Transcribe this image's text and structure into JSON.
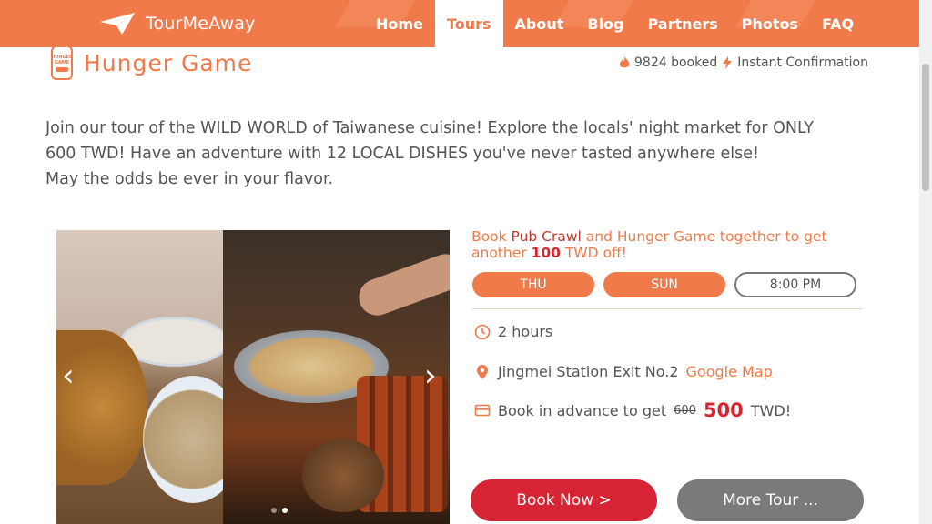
{
  "nav": {
    "brand": "TourMeAway",
    "items": [
      {
        "label": "Home",
        "active": false
      },
      {
        "label": "Tours",
        "active": true
      },
      {
        "label": "About",
        "active": false
      },
      {
        "label": "Blog",
        "active": false
      },
      {
        "label": "Partners",
        "active": false
      },
      {
        "label": "Photos",
        "active": false
      },
      {
        "label": "FAQ",
        "active": false
      }
    ]
  },
  "colors": {
    "accent": "#f07a4a",
    "book": "#d62434",
    "more": "#7a7a7a",
    "price": "#d6252f"
  },
  "tour": {
    "badge_text": "HUNGER GAME",
    "title": "Hunger Game",
    "booked": "9824 booked",
    "instant": "Instant Confirmation",
    "desc_line1": "Join our tour of the WILD WORLD of Taiwanese cuisine! Explore the locals' night market for ONLY",
    "desc_line2": "600 TWD! Have an adventure with 12 LOCAL DISHES you've never tasted anywhere else!",
    "desc_line3": "May the odds be ever in your flavor."
  },
  "promo": {
    "p1": "Book ",
    "pub": "Pub Crawl",
    "p2": " and Hunger Game together to get",
    "p3": "another ",
    "amount": "100",
    "p4": " TWD off!"
  },
  "schedule": {
    "day1": "THU",
    "day2": "SUN",
    "time": "8:00 PM"
  },
  "details": {
    "duration": "2 hours",
    "location": "Jingmei Station Exit No.2",
    "map_link": "Google Map",
    "advance_text": "Book in advance to get",
    "old_price": "600",
    "new_price": "500",
    "currency": "TWD!"
  },
  "buttons": {
    "book": "Book Now >",
    "more": "More Tour ..."
  },
  "carousel": {
    "prev": "‹",
    "next": "›",
    "slide_count": 2,
    "active_slide": 2
  }
}
